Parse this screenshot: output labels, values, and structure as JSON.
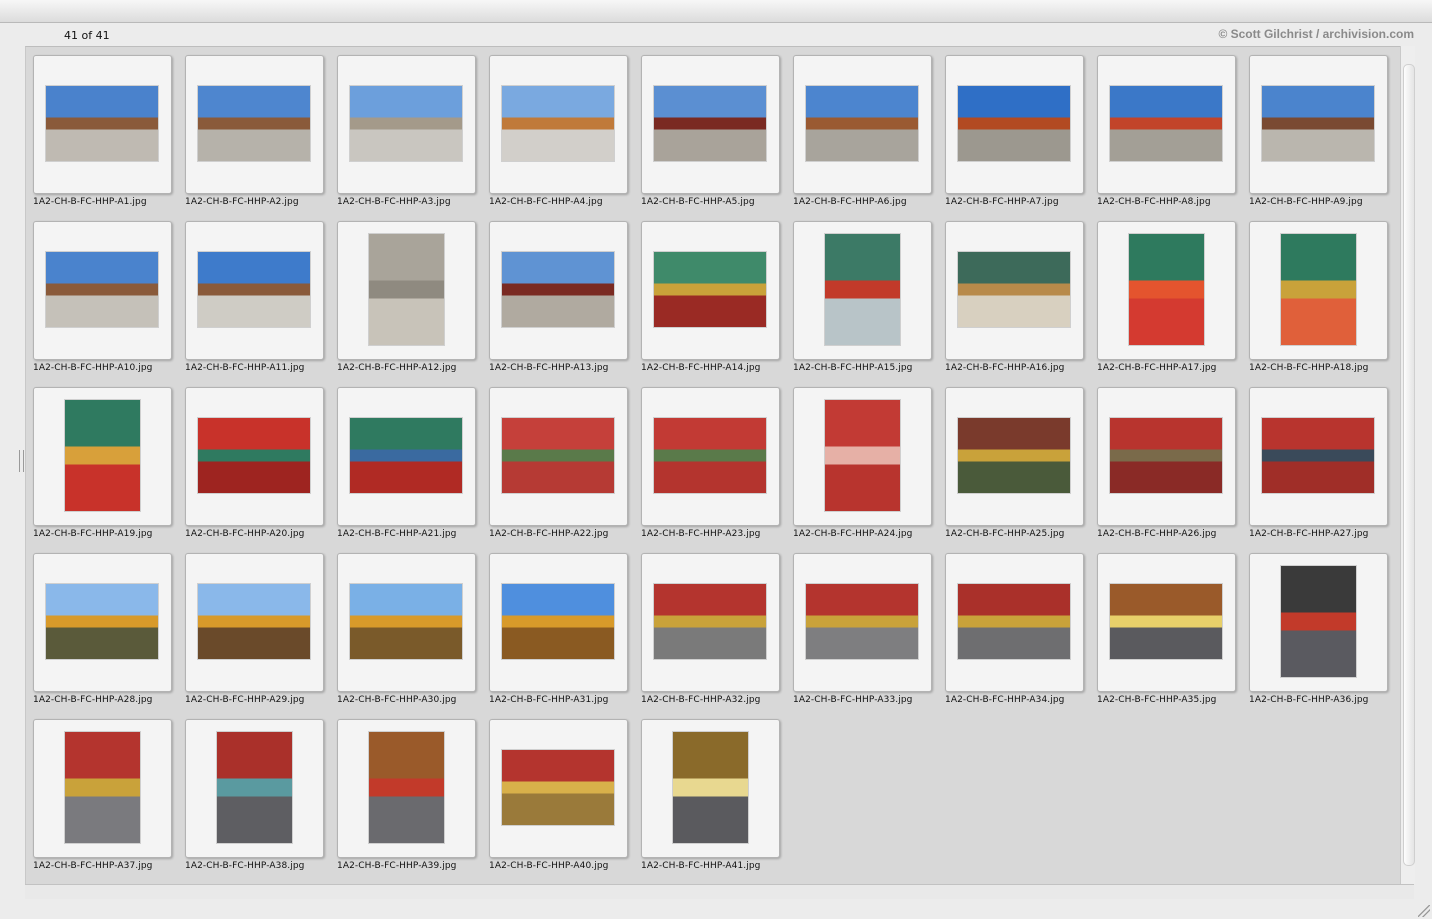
{
  "header": {
    "counter": "41 of 41",
    "credit": "© Scott Gilchrist / archivision.com"
  },
  "thumbnails": [
    {
      "name": "1A2-CH-B-FC-HHP-A1.jpg",
      "orient": "landscape",
      "top": "#4a82cc",
      "bottom": "#bfbab2",
      "accent": "#8a5a3a"
    },
    {
      "name": "1A2-CH-B-FC-HHP-A2.jpg",
      "orient": "landscape",
      "top": "#4e86cf",
      "bottom": "#b6b2aa",
      "accent": "#8a5a3a"
    },
    {
      "name": "1A2-CH-B-FC-HHP-A3.jpg",
      "orient": "landscape",
      "top": "#6c9fdc",
      "bottom": "#c9c6c0",
      "accent": "#a49a8a"
    },
    {
      "name": "1A2-CH-B-FC-HHP-A4.jpg",
      "orient": "landscape",
      "top": "#7aa9e0",
      "bottom": "#d2cfca",
      "accent": "#c07a3a"
    },
    {
      "name": "1A2-CH-B-FC-HHP-A5.jpg",
      "orient": "landscape",
      "top": "#5b8fd2",
      "bottom": "#a9a39a",
      "accent": "#7a2a22"
    },
    {
      "name": "1A2-CH-B-FC-HHP-A6.jpg",
      "orient": "landscape",
      "top": "#4c85cf",
      "bottom": "#a8a49c",
      "accent": "#9a5a32"
    },
    {
      "name": "1A2-CH-B-FC-HHP-A7.jpg",
      "orient": "landscape",
      "top": "#2f6fc6",
      "bottom": "#9c988f",
      "accent": "#b24a22"
    },
    {
      "name": "1A2-CH-B-FC-HHP-A8.jpg",
      "orient": "landscape",
      "top": "#3b78c8",
      "bottom": "#a39f96",
      "accent": "#c2442a"
    },
    {
      "name": "1A2-CH-B-FC-HHP-A9.jpg",
      "orient": "landscape",
      "top": "#4b84cd",
      "bottom": "#bab6ae",
      "accent": "#7a4a32"
    },
    {
      "name": "1A2-CH-B-FC-HHP-A10.jpg",
      "orient": "landscape",
      "top": "#4a83cd",
      "bottom": "#c5c1b9",
      "accent": "#8a5a3a"
    },
    {
      "name": "1A2-CH-B-FC-HHP-A11.jpg",
      "orient": "landscape",
      "top": "#3e7bcb",
      "bottom": "#cfccc5",
      "accent": "#8a5a3a"
    },
    {
      "name": "1A2-CH-B-FC-HHP-A12.jpg",
      "orient": "portrait",
      "top": "#a9a49a",
      "bottom": "#c8c3b9",
      "accent": "#8f8a80"
    },
    {
      "name": "1A2-CH-B-FC-HHP-A13.jpg",
      "orient": "landscape",
      "top": "#5f93d3",
      "bottom": "#b0aaa0",
      "accent": "#7a2a22"
    },
    {
      "name": "1A2-CH-B-FC-HHP-A14.jpg",
      "orient": "landscape",
      "top": "#3f8a6a",
      "bottom": "#9a2a24",
      "accent": "#c9a23a"
    },
    {
      "name": "1A2-CH-B-FC-HHP-A15.jpg",
      "orient": "portrait",
      "top": "#3c7a66",
      "bottom": "#b8c4c8",
      "accent": "#c23a2a"
    },
    {
      "name": "1A2-CH-B-FC-HHP-A16.jpg",
      "orient": "landscape",
      "top": "#3d6a5a",
      "bottom": "#d8d0c0",
      "accent": "#b88a4a"
    },
    {
      "name": "1A2-CH-B-FC-HHP-A17.jpg",
      "orient": "portrait",
      "top": "#2e7a5e",
      "bottom": "#d43a30",
      "accent": "#e4542e"
    },
    {
      "name": "1A2-CH-B-FC-HHP-A18.jpg",
      "orient": "portrait",
      "top": "#2e7a5e",
      "bottom": "#e0603a",
      "accent": "#c9a23a"
    },
    {
      "name": "1A2-CH-B-FC-HHP-A19.jpg",
      "orient": "portrait",
      "top": "#2f7a60",
      "bottom": "#c8322a",
      "accent": "#d8a03a"
    },
    {
      "name": "1A2-CH-B-FC-HHP-A20.jpg",
      "orient": "landscape",
      "top": "#c8322a",
      "bottom": "#9e2420",
      "accent": "#2f7a60"
    },
    {
      "name": "1A2-CH-B-FC-HHP-A21.jpg",
      "orient": "landscape",
      "top": "#2f7a60",
      "bottom": "#b02a24",
      "accent": "#3a6aa0"
    },
    {
      "name": "1A2-CH-B-FC-HHP-A22.jpg",
      "orient": "landscape",
      "top": "#c5403a",
      "bottom": "#b63a34",
      "accent": "#5a7a4a"
    },
    {
      "name": "1A2-CH-B-FC-HHP-A23.jpg",
      "orient": "landscape",
      "top": "#c23a34",
      "bottom": "#b4342e",
      "accent": "#5a7a4a"
    },
    {
      "name": "1A2-CH-B-FC-HHP-A24.jpg",
      "orient": "portrait",
      "top": "#c23a34",
      "bottom": "#b8342e",
      "accent": "#e6b0a6"
    },
    {
      "name": "1A2-CH-B-FC-HHP-A25.jpg",
      "orient": "landscape",
      "top": "#7a3a2c",
      "bottom": "#4a5a3a",
      "accent": "#c9a23a"
    },
    {
      "name": "1A2-CH-B-FC-HHP-A26.jpg",
      "orient": "landscape",
      "top": "#b8342e",
      "bottom": "#8a2a26",
      "accent": "#7a6a4a"
    },
    {
      "name": "1A2-CH-B-FC-HHP-A27.jpg",
      "orient": "landscape",
      "top": "#b8342e",
      "bottom": "#a02e28",
      "accent": "#3a4a5a"
    },
    {
      "name": "1A2-CH-B-FC-HHP-A28.jpg",
      "orient": "landscape",
      "top": "#8ab8ea",
      "bottom": "#5a5a3a",
      "accent": "#d89a2a"
    },
    {
      "name": "1A2-CH-B-FC-HHP-A29.jpg",
      "orient": "landscape",
      "top": "#8ab8ea",
      "bottom": "#6a4a2a",
      "accent": "#d89a2a"
    },
    {
      "name": "1A2-CH-B-FC-HHP-A30.jpg",
      "orient": "landscape",
      "top": "#7ab0e6",
      "bottom": "#7a5a2a",
      "accent": "#d89a2a"
    },
    {
      "name": "1A2-CH-B-FC-HHP-A31.jpg",
      "orient": "landscape",
      "top": "#4f8fde",
      "bottom": "#8a5a22",
      "accent": "#d89a2a"
    },
    {
      "name": "1A2-CH-B-FC-HHP-A32.jpg",
      "orient": "landscape",
      "top": "#b4342e",
      "bottom": "#7a7a7a",
      "accent": "#c9a23a"
    },
    {
      "name": "1A2-CH-B-FC-HHP-A33.jpg",
      "orient": "landscape",
      "top": "#b4342e",
      "bottom": "#7e7e80",
      "accent": "#c9a23a"
    },
    {
      "name": "1A2-CH-B-FC-HHP-A34.jpg",
      "orient": "landscape",
      "top": "#aa302a",
      "bottom": "#6e6e70",
      "accent": "#c9a23a"
    },
    {
      "name": "1A2-CH-B-FC-HHP-A35.jpg",
      "orient": "landscape",
      "top": "#9a5a2a",
      "bottom": "#5a5a5e",
      "accent": "#e8d06a"
    },
    {
      "name": "1A2-CH-B-FC-HHP-A36.jpg",
      "orient": "portrait",
      "top": "#3a3a3a",
      "bottom": "#5a5a60",
      "accent": "#c23a2a"
    },
    {
      "name": "1A2-CH-B-FC-HHP-A37.jpg",
      "orient": "portrait",
      "top": "#b4342e",
      "bottom": "#7a7a7e",
      "accent": "#c9a23a"
    },
    {
      "name": "1A2-CH-B-FC-HHP-A38.jpg",
      "orient": "portrait",
      "top": "#aa302a",
      "bottom": "#5e5e62",
      "accent": "#5a9aa0"
    },
    {
      "name": "1A2-CH-B-FC-HHP-A39.jpg",
      "orient": "portrait",
      "top": "#9a5a2a",
      "bottom": "#6a6a6e",
      "accent": "#c23a2a"
    },
    {
      "name": "1A2-CH-B-FC-HHP-A40.jpg",
      "orient": "landscape",
      "top": "#b4342e",
      "bottom": "#9a7a3a",
      "accent": "#d8b04a"
    },
    {
      "name": "1A2-CH-B-FC-HHP-A41.jpg",
      "orient": "portrait",
      "top": "#8a6a2a",
      "bottom": "#5a5a5e",
      "accent": "#e8d890"
    }
  ]
}
